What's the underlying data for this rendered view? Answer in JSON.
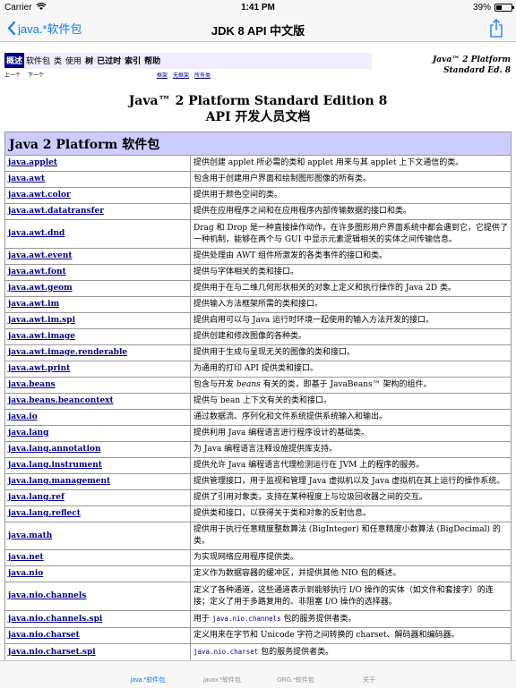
{
  "status": {
    "carrier": "Carrier",
    "time": "1:41 PM",
    "battery": "39%",
    "battery_level": 0.39
  },
  "nav": {
    "back_label": "java.*软件包",
    "title": "JDK 8 API 中文版"
  },
  "doc": {
    "topnav": [
      "概述",
      "软件包",
      "类",
      "使用",
      "树",
      "已过时",
      "索引",
      "帮助"
    ],
    "subnav": [
      "上一个",
      "下一个"
    ],
    "sublinks": [
      "框架",
      "无框架",
      "所有类"
    ],
    "platform_line1": "Java™ 2 Platform",
    "platform_line2": "Standard Ed. 8",
    "title_line1": "Java™ 2 Platform Standard Edition 8",
    "title_line2": "API 开发人员文档",
    "table_header": "Java 2 Platform 软件包",
    "packages": [
      {
        "name": "java.applet",
        "desc": "提供创建 applet 所必需的类和 applet 用来与其 applet 上下文通信的类。"
      },
      {
        "name": "java.awt",
        "desc": "包含用于创建用户界面和绘制图形图像的所有类。"
      },
      {
        "name": "java.awt.color",
        "desc": "提供用于颜色空间的类。"
      },
      {
        "name": "java.awt.datatransfer",
        "desc": "提供在应用程序之间和在应用程序内部传输数据的接口和类。"
      },
      {
        "name": "java.awt.dnd",
        "desc": "Drag 和 Drop 是一种直接操作动作，在许多图形用户界面系统中都会遇到它，它提供了一种机制，能够在两个与 GUI 中显示元素逻辑相关的实体之间传输信息。"
      },
      {
        "name": "java.awt.event",
        "desc": "提供处理由 AWT 组件所激发的各类事件的接口和类。"
      },
      {
        "name": "java.awt.font",
        "desc": "提供与字体相关的类和接口。"
      },
      {
        "name": "java.awt.geom",
        "desc": "提供用于在与二维几何形状相关的对象上定义和执行操作的 Java 2D 类。"
      },
      {
        "name": "java.awt.im",
        "desc": "提供输入方法框架所需的类和接口。"
      },
      {
        "name": "java.awt.im.spi",
        "desc": "提供启用可以与 Java 运行时环境一起使用的输入方法开发的接口。"
      },
      {
        "name": "java.awt.image",
        "desc": "提供创建和修改图像的各种类。"
      },
      {
        "name": "java.awt.image.renderable",
        "desc": "提供用于生成与呈现无关的图像的类和接口。"
      },
      {
        "name": "java.awt.print",
        "desc": "为通用的打印 API 提供类和接口。"
      },
      {
        "name": "java.beans",
        "desc_pre": "包含与开发 ",
        "desc_em": "beans",
        "desc_post": " 有关的类，即基于 JavaBeans™ 架构的组件。"
      },
      {
        "name": "java.beans.beancontext",
        "desc": "提供与 bean 上下文有关的类和接口。"
      },
      {
        "name": "java.io",
        "desc": "通过数据流、序列化和文件系统提供系统输入和输出。"
      },
      {
        "name": "java.lang",
        "desc": "提供利用 Java 编程语言进行程序设计的基础类。"
      },
      {
        "name": "java.lang.annotation",
        "desc": "为 Java 编程语言注释设施提供库支持。"
      },
      {
        "name": "java.lang.instrument",
        "desc": "提供允许 Java 编程语言代理检测运行在 JVM 上的程序的服务。"
      },
      {
        "name": "java.lang.management",
        "desc": "提供管理接口，用于监视和管理 Java 虚拟机以及 Java 虚拟机在其上运行的操作系统。"
      },
      {
        "name": "java.lang.ref",
        "desc": "提供了引用对象类，支持在某种程度上与垃圾回收器之间的交互。"
      },
      {
        "name": "java.lang.reflect",
        "desc": "提供类和接口，以获得关于类和对象的反射信息。"
      },
      {
        "name": "java.math",
        "desc": "提供用于执行任意精度整数算法 (BigInteger) 和任意精度小数算法 (BigDecimal) 的类。"
      },
      {
        "name": "java.net",
        "desc": "为实现网络应用程序提供类。"
      },
      {
        "name": "java.nio",
        "desc": "定义作为数据容器的缓冲区，并提供其他 NIO 包的概述。"
      },
      {
        "name": "java.nio.channels",
        "desc": "定义了各种通道，这些通道表示到能够执行 I/O 操作的实体（如文件和套接字）的连接；定义了用于多路复用的、非阻塞 I/O 操作的选择器。"
      },
      {
        "name": "java.nio.channels.spi",
        "desc_pre": "用于 ",
        "desc_code": "java.nio.channels",
        "desc_post": " 包的服务提供者类。"
      },
      {
        "name": "java.nio.charset",
        "desc": "定义用来在字节和 Unicode 字符之间转换的 charset、解码器和编码器。"
      },
      {
        "name": "java.nio.charset.spi",
        "desc_pre": "",
        "desc_code": "java.nio.charset",
        "desc_post": " 包的服务提供者类。"
      }
    ]
  },
  "tabs": [
    "java.*软件包",
    "javax.*软件包",
    "ORG.*软件包",
    "关于"
  ],
  "colors": {
    "accent": "#0a7bff",
    "header_bg": "#ccccff",
    "link": "#00008b"
  }
}
